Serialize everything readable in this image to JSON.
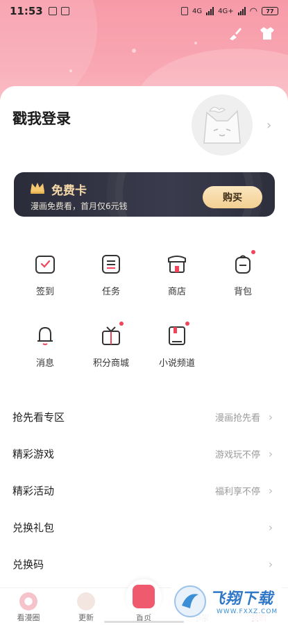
{
  "status_bar": {
    "time": "11:53",
    "network": "4G",
    "network2": "4G+",
    "battery": "77"
  },
  "profile": {
    "login_text": "戳我登录"
  },
  "vip": {
    "title": "免费卡",
    "subtitle": "漫画免费看，首月仅6元钱",
    "buy_label": "购买"
  },
  "grid": [
    {
      "label": "签到",
      "icon": "calendar-check-icon",
      "badge": false
    },
    {
      "label": "任务",
      "icon": "task-list-icon",
      "badge": false
    },
    {
      "label": "商店",
      "icon": "shop-icon",
      "badge": false
    },
    {
      "label": "背包",
      "icon": "backpack-icon",
      "badge": true
    },
    {
      "label": "消息",
      "icon": "bell-icon",
      "badge": false
    },
    {
      "label": "积分商城",
      "icon": "gift-box-icon",
      "badge": true
    },
    {
      "label": "小说频道",
      "icon": "book-icon",
      "badge": true
    }
  ],
  "menu": [
    {
      "title": "抢先看专区",
      "hint": "漫画抢先看"
    },
    {
      "title": "精彩游戏",
      "hint": "游戏玩不停"
    },
    {
      "title": "精彩活动",
      "hint": "福利享不停"
    },
    {
      "title": "兑换礼包",
      "hint": ""
    },
    {
      "title": "兑换码",
      "hint": ""
    }
  ],
  "tabs": [
    {
      "label": "看漫圈",
      "icon": "donut-icon"
    },
    {
      "label": "更新",
      "icon": "paw-icon"
    },
    {
      "label": "首页",
      "icon": "home-mascot-icon"
    },
    {
      "label": "书架",
      "icon": "bookshelf-icon"
    },
    {
      "label": "我的",
      "icon": "profile-icon"
    }
  ],
  "watermark": {
    "big": "飞翔下载",
    "small": "WWW.FXXZ.COM"
  },
  "colors": {
    "accent": "#f0445a",
    "hero": "#f79aa8",
    "vip_bg": "#2b2c3a",
    "vip_gold": "#f5d9a8"
  }
}
